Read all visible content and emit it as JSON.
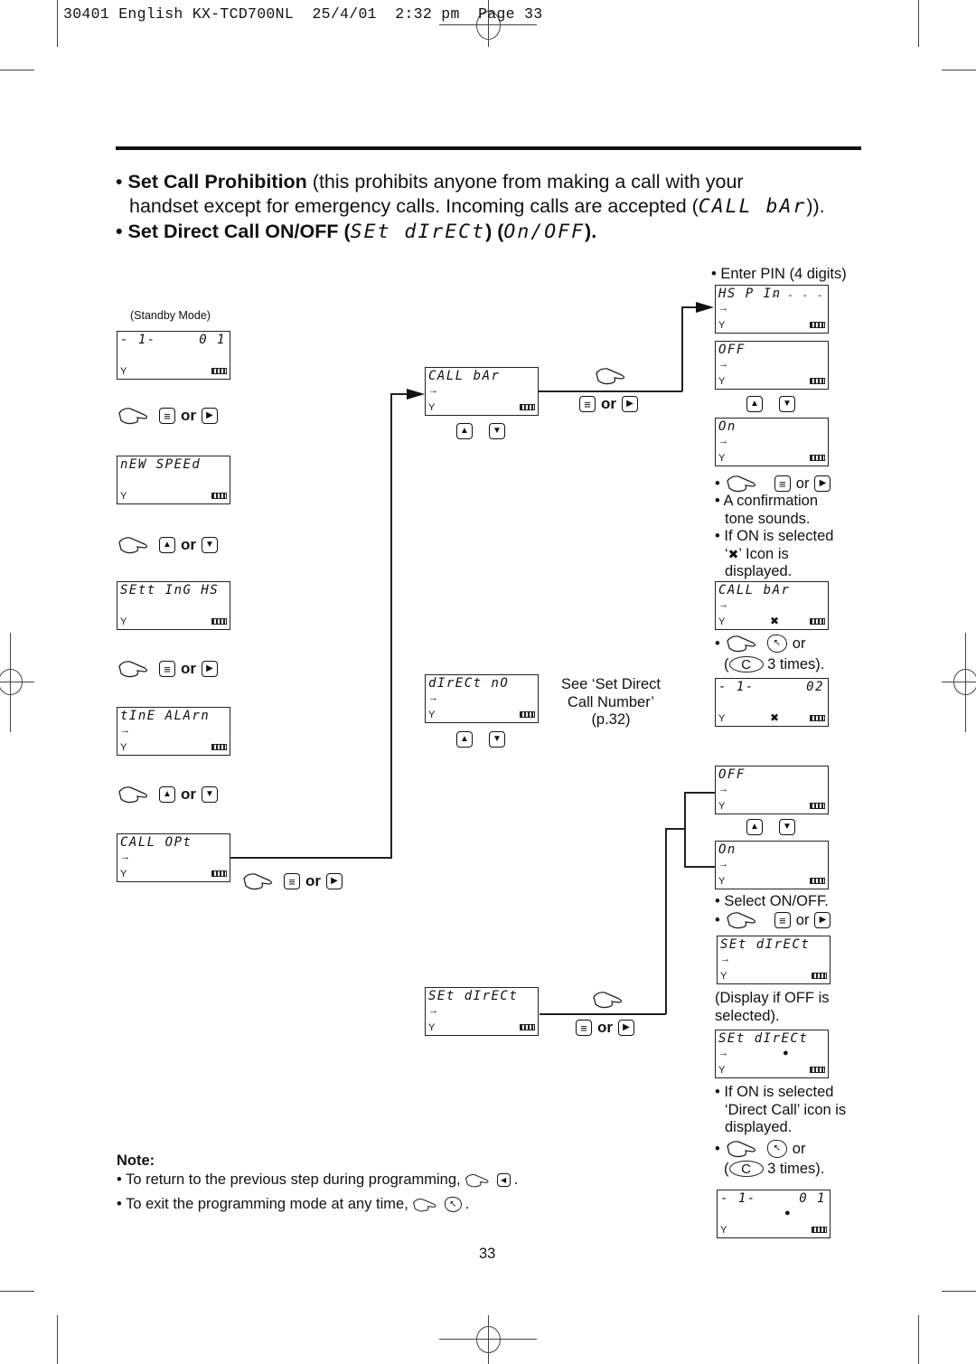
{
  "header": {
    "print_slug": "30401 English KX-TCD700NL  25/4/01  2:32 pm  Page 33"
  },
  "intro": {
    "item1_bold": "Set Call Prohibition",
    "item1_text": " (this prohibits anyone from making a call with your",
    "item1_text2": "handset except for emergency calls. Incoming calls are accepted (",
    "item1_lcd": "CALL bAr",
    "item1_close": ")).",
    "item2_bold": "Set Direct Call ON/OFF (",
    "item2_lcd1": "SEt dIrECt",
    "item2_mid": ") (",
    "item2_lcd2": "On/OFF",
    "item2_close": ")."
  },
  "common": {
    "or": "or",
    "bullet": "•",
    "enter_symbol": "→",
    "antenna_symbol": "Y",
    "up_symbol": "▲",
    "down_symbol": "▼",
    "right_symbol": "▶",
    "left_symbol": "◀",
    "menu_symbol": "≡",
    "c_key": "C",
    "off_key_symbol": "↖",
    "callbar_icon": "✖",
    "direct_icon": "●"
  },
  "column1": {
    "standby_label": "(Standby Mode)",
    "lcds": [
      {
        "line1": "- 1-",
        "right": "0 1",
        "enter": false
      },
      {
        "line1": "nEW SPEEd",
        "right": "",
        "enter": false
      },
      {
        "line1": "SEtt InG HS",
        "right": "",
        "enter": false
      },
      {
        "line1": "tInE ALArn",
        "right": "",
        "enter": true
      },
      {
        "line1": "CALL OPt",
        "right": "",
        "enter": true
      }
    ],
    "steps": [
      {
        "key1": "menu",
        "key2": "right"
      },
      {
        "key1": "up",
        "key2": "down"
      },
      {
        "key1": "menu",
        "key2": "right"
      },
      {
        "key1": "up",
        "key2": "down"
      },
      {
        "key1": "menu",
        "key2": "right"
      }
    ]
  },
  "column2": {
    "lcds": [
      {
        "line1": "CALL bAr",
        "enter": true
      },
      {
        "line1": "dIrECt nO",
        "enter": true
      },
      {
        "line1": "SEt dIrECt",
        "enter": true
      }
    ],
    "see_note": [
      "See ‘Set Direct",
      "Call Number’",
      "(p.32)"
    ]
  },
  "column3": {
    "enter_pin": "• Enter PIN (4 digits)",
    "lcd_pin": {
      "line1": "HS P In",
      "right": "- - - -"
    },
    "lcd_off1": {
      "line1": "OFF"
    },
    "lcd_on1": {
      "line1": "On"
    },
    "notes1": [
      "A confirmation",
      "tone sounds.",
      "If ON is selected",
      "’ Icon is",
      "displayed."
    ],
    "lcd_callbar_result": {
      "line1": "CALL bAr"
    },
    "times_text": "3 times).",
    "lcd_standby_02": {
      "line1": "- 1-",
      "right": "02"
    },
    "lcd_off2": {
      "line1": "OFF"
    },
    "lcd_on2": {
      "line1": "On"
    },
    "select_onoff": "• Select ON/OFF.",
    "lcd_setdirect_off": {
      "line1": "SEt dIrECt"
    },
    "display_if_off": [
      "(Display if OFF is",
      "selected)."
    ],
    "lcd_setdirect_on": {
      "line1": "SEt dIrECt"
    },
    "notes2": [
      "If ON is selected",
      "‘Direct Call’ icon is",
      "displayed."
    ],
    "lcd_standby_01": {
      "line1": "- 1-",
      "right": "0 1"
    }
  },
  "note": {
    "title": "Note:",
    "line1": "• To return to the previous step during programming,",
    "line2": "• To exit the programming mode at any time,"
  },
  "page_number": "33"
}
